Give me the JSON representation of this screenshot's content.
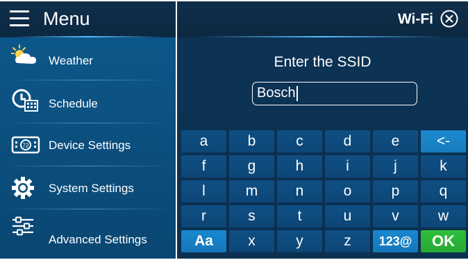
{
  "menu": {
    "title": "Menu",
    "items": [
      {
        "label": "Weather",
        "icon": "weather-icon"
      },
      {
        "label": "Schedule",
        "icon": "schedule-icon"
      },
      {
        "label": "Device Settings",
        "icon": "device-settings-icon"
      },
      {
        "label": "System Settings",
        "icon": "gear-icon"
      },
      {
        "label": "Advanced Settings",
        "icon": "sliders-icon"
      }
    ]
  },
  "wifi": {
    "title": "Wi-Fi",
    "close_icon": "close-circle-icon",
    "prompt": "Enter the SSID",
    "ssid_value": "Bosch"
  },
  "keyboard": {
    "keys": [
      "a",
      "b",
      "c",
      "d",
      "e",
      "<-",
      "f",
      "g",
      "h",
      "i",
      "j",
      "k",
      "l",
      "m",
      "n",
      "o",
      "p",
      "q",
      "r",
      "s",
      "t",
      "u",
      "v",
      "w",
      "Aa",
      "x",
      "y",
      "z",
      "123@",
      "OK"
    ]
  },
  "colors": {
    "menu_bg": "#0b4f7e",
    "panel_bg": "#0c3356",
    "key_bg": "#0f4f83",
    "accent_blue": "#1888cf",
    "ok_green": "#2fbf3c"
  }
}
